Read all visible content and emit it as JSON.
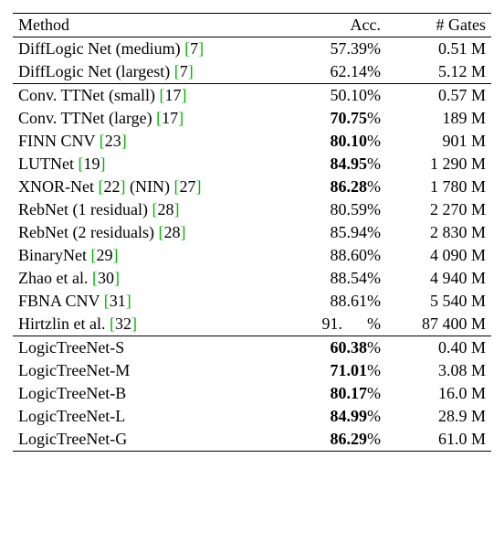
{
  "headers": {
    "method": "Method",
    "acc": "Acc.",
    "gates": "# Gates"
  },
  "groups": [
    {
      "rows": [
        {
          "name": "DiffLogic Net (medium)",
          "refs": [
            "7"
          ],
          "acc": "57.39",
          "bold": false,
          "gates_n": "0.51",
          "gates_u": "M"
        },
        {
          "name": "DiffLogic Net (largest)",
          "refs": [
            "7"
          ],
          "acc": "62.14",
          "bold": false,
          "gates_n": "5.12",
          "gates_u": "M"
        }
      ]
    },
    {
      "rows": [
        {
          "name": "Conv. TTNet (small)",
          "refs": [
            "17"
          ],
          "acc": "50.10",
          "bold": false,
          "gates_n": "0.57",
          "gates_u": "M"
        },
        {
          "name": "Conv. TTNet (large)",
          "refs": [
            "17"
          ],
          "acc": "70.75",
          "bold": true,
          "gates_n": "189",
          "gates_u": "M"
        },
        {
          "name": "FINN CNV",
          "refs": [
            "23"
          ],
          "acc": "80.10",
          "bold": true,
          "gates_n": "901",
          "gates_u": "M"
        },
        {
          "name": "LUTNet",
          "refs": [
            "19"
          ],
          "acc": "84.95",
          "bold": true,
          "gates_n": "1 290",
          "gates_u": "M"
        },
        {
          "name_parts": [
            "XNOR-Net",
            " (NIN)"
          ],
          "refs_inline": [
            [
              "22"
            ],
            [
              "27"
            ]
          ],
          "acc": "86.28",
          "bold": true,
          "gates_n": "1 780",
          "gates_u": "M"
        },
        {
          "name": "RebNet (1 residual)",
          "refs": [
            "28"
          ],
          "acc": "80.59",
          "bold": false,
          "gates_n": "2 270",
          "gates_u": "M"
        },
        {
          "name": "RebNet (2 residuals)",
          "refs": [
            "28"
          ],
          "acc": "85.94",
          "bold": false,
          "gates_n": "2 830",
          "gates_u": "M"
        },
        {
          "name": "BinaryNet",
          "refs": [
            "29"
          ],
          "acc": "88.60",
          "bold": false,
          "gates_n": "4 090",
          "gates_u": "M"
        },
        {
          "name": "Zhao et al.",
          "refs": [
            "30"
          ],
          "acc": "88.54",
          "bold": false,
          "gates_n": "4 940",
          "gates_u": "M"
        },
        {
          "name": "FBNA CNV",
          "refs": [
            "31"
          ],
          "acc": "88.61",
          "bold": false,
          "gates_n": "5 540",
          "gates_u": "M"
        },
        {
          "name": "Hirtzlin et al.",
          "refs": [
            "32"
          ],
          "acc": "91.   ",
          "bold": false,
          "gates_n": "87 400",
          "gates_u": "M"
        }
      ]
    },
    {
      "rows": [
        {
          "name": "LogicTreeNet-S",
          "refs": [],
          "acc": "60.38",
          "bold": true,
          "gates_n": "0.40",
          "gates_u": "M"
        },
        {
          "name": "LogicTreeNet-M",
          "refs": [],
          "acc": "71.01",
          "bold": true,
          "gates_n": "3.08",
          "gates_u": "M"
        },
        {
          "name": "LogicTreeNet-B",
          "refs": [],
          "acc": "80.17",
          "bold": true,
          "gates_n": "16.0",
          "gates_u": "M"
        },
        {
          "name": "LogicTreeNet-L",
          "refs": [],
          "acc": "84.99",
          "bold": true,
          "gates_n": "28.9",
          "gates_u": "M"
        },
        {
          "name": "LogicTreeNet-G",
          "refs": [],
          "acc": "86.29",
          "bold": true,
          "gates_n": "61.0",
          "gates_u": "M"
        }
      ]
    }
  ]
}
